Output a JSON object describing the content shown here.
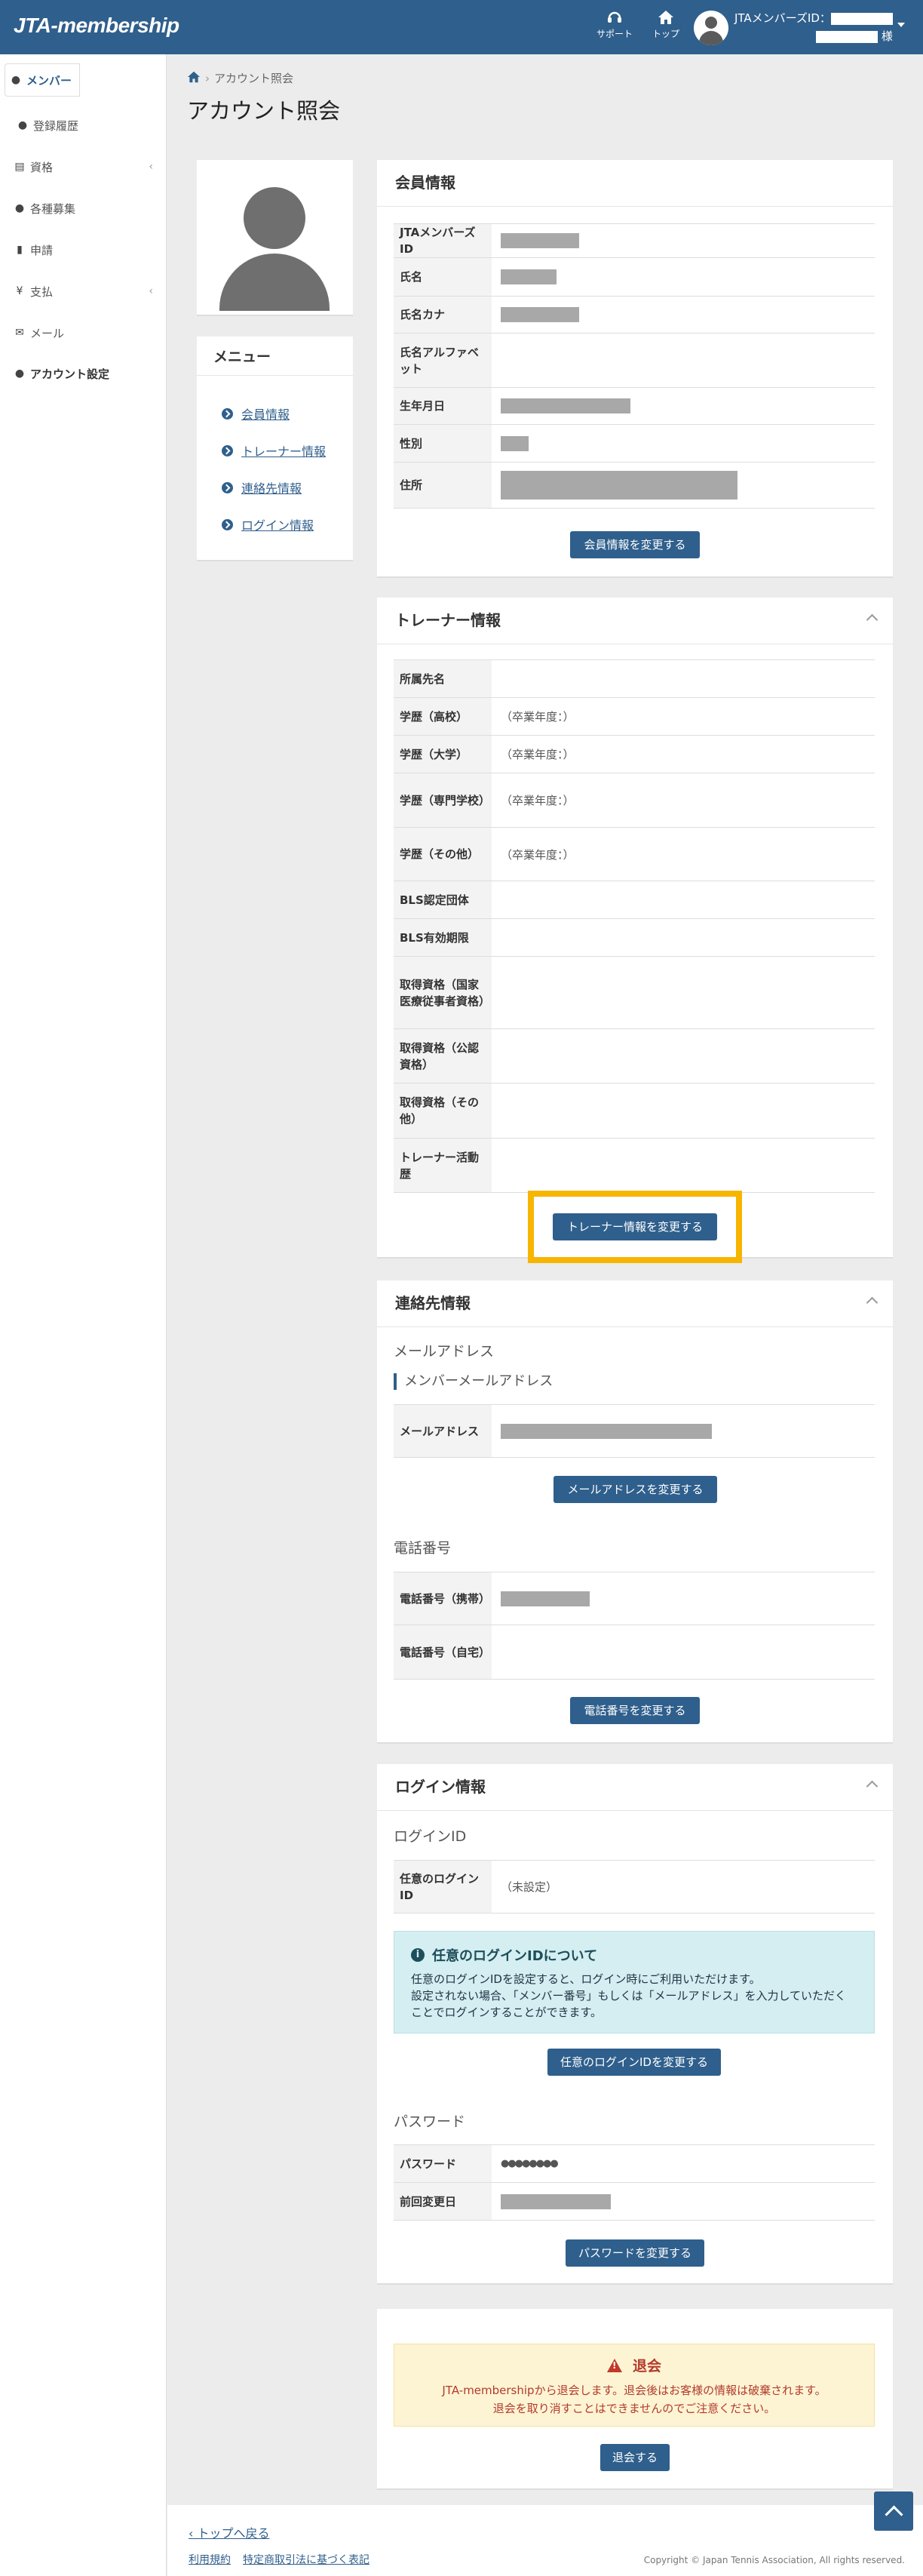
{
  "header": {
    "logo": "JTA-membership",
    "support_label": "サポート",
    "top_label": "トップ",
    "member_id_label": "JTAメンバーズID：",
    "honorific": "様"
  },
  "sidebar": {
    "items": [
      {
        "label": "メンバー"
      },
      {
        "label": "登録履歴"
      },
      {
        "label": "資格"
      },
      {
        "label": "各種募集"
      },
      {
        "label": "申請"
      },
      {
        "label": "支払"
      },
      {
        "label": "メール"
      },
      {
        "label": "アカウント設定"
      }
    ]
  },
  "breadcrumb": {
    "current": "アカウント照会"
  },
  "page_title": "アカウント照会",
  "menu": {
    "title": "メニュー",
    "links": [
      "会員情報",
      "トレーナー情報",
      "連絡先情報",
      "ログイン情報"
    ]
  },
  "member": {
    "title": "会員情報",
    "rows": [
      "JTAメンバーズID",
      "氏名",
      "氏名カナ",
      "氏名アルファベット",
      "生年月日",
      "性別",
      "住所"
    ],
    "button": "会員情報を変更する"
  },
  "trainer": {
    "title": "トレーナー情報",
    "rows": [
      {
        "label": "所属先名",
        "value": ""
      },
      {
        "label": "学歴（高校）",
        "value": "（卒業年度：）"
      },
      {
        "label": "学歴（大学）",
        "value": "（卒業年度：）"
      },
      {
        "label": "学歴（専門学校）",
        "value": "（卒業年度：）"
      },
      {
        "label": "学歴（その他）",
        "value": "（卒業年度：）"
      },
      {
        "label": "BLS認定団体",
        "value": ""
      },
      {
        "label": "BLS有効期限",
        "value": ""
      },
      {
        "label": "取得資格（国家医療従事者資格）",
        "value": ""
      },
      {
        "label": "取得資格（公認資格）",
        "value": ""
      },
      {
        "label": "取得資格（その他）",
        "value": ""
      },
      {
        "label": "トレーナー活動歴",
        "value": ""
      }
    ],
    "button": "トレーナー情報を変更する"
  },
  "contact": {
    "title": "連絡先情報",
    "email_heading": "メールアドレス",
    "email_sub": "メンバーメールアドレス",
    "email_label": "メールアドレス",
    "email_button": "メールアドレスを変更する",
    "phone_heading": "電話番号",
    "phone_mobile": "電話番号（携帯）",
    "phone_home": "電話番号（自宅）",
    "phone_button": "電話番号を変更する"
  },
  "login": {
    "title": "ログイン情報",
    "id_heading": "ログインID",
    "id_label": "任意のログインID",
    "id_value": "（未設定）",
    "info_title": "任意のログインIDについて",
    "info_line1": "任意のログインIDを設定すると、ログイン時にご利用いただけます。",
    "info_line2": "設定されない場合、「メンバー番号」もしくは「メールアドレス」を入力していただくことでログインすることができます。",
    "id_button": "任意のログインIDを変更する",
    "pw_heading": "パスワード",
    "pw_label": "パスワード",
    "pw_value": "●●●●●●●●",
    "changed_label": "前回変更日",
    "pw_button": "パスワードを変更する"
  },
  "withdraw": {
    "title": "退会",
    "line1": "JTA-membershipから退会します。退会後はお客様の情報は破棄されます。",
    "line2": "退会を取り消すことはできませんのでご注意ください。",
    "button": "退会する"
  },
  "footer": {
    "back": "トップへ戻る",
    "terms": "利用規約",
    "law": "特定商取引法に基づく表記",
    "copyright": "Copyright © Japan Tennis Association, All rights reserved."
  }
}
